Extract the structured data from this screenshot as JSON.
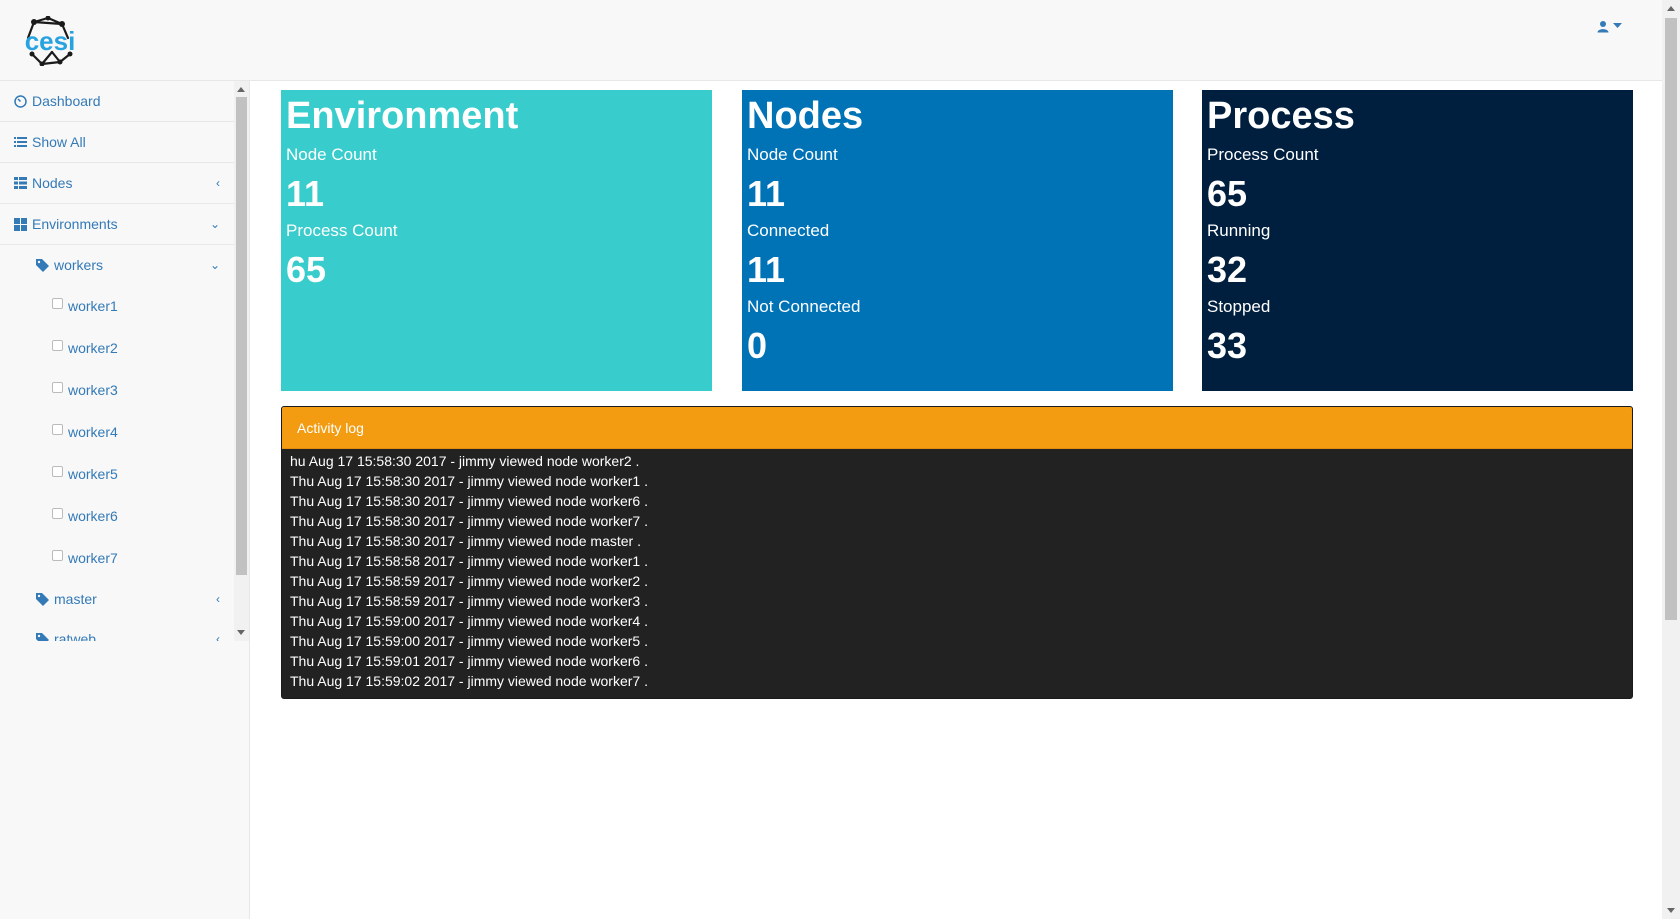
{
  "header": {
    "logo_text": "cesi",
    "user_icon": "user-icon",
    "caret_icon": "caret-down-icon"
  },
  "sidebar": {
    "items": [
      {
        "label": "Dashboard",
        "icon": "dashboard-icon"
      },
      {
        "label": "Show All",
        "icon": "list-icon"
      },
      {
        "label": "Nodes",
        "icon": "table-icon"
      },
      {
        "label": "Environments",
        "icon": "grid-icon"
      }
    ],
    "groups": [
      {
        "label": "workers",
        "icon": "tag-icon"
      },
      {
        "label": "master",
        "icon": "tag-icon"
      },
      {
        "label": "ratweb",
        "icon": "tag-icon"
      }
    ],
    "workers": [
      "worker1",
      "worker2",
      "worker3",
      "worker4",
      "worker5",
      "worker6",
      "worker7"
    ]
  },
  "cards": {
    "environment": {
      "title": "Environment",
      "node_count_label": "Node Count",
      "node_count": "11",
      "process_count_label": "Process Count",
      "process_count": "65",
      "color": "#39cccc"
    },
    "nodes": {
      "title": "Nodes",
      "node_count_label": "Node Count",
      "node_count": "11",
      "connected_label": "Connected",
      "connected": "11",
      "not_connected_label": "Not Connected",
      "not_connected": "0",
      "color": "#0073b7"
    },
    "process": {
      "title": "Process",
      "process_count_label": "Process Count",
      "process_count": "65",
      "running_label": "Running",
      "running": "32",
      "stopped_label": "Stopped",
      "stopped": "33",
      "color": "#001f3f"
    }
  },
  "activity_log": {
    "title": "Activity log",
    "color": "#f39c12",
    "entries": [
      "hu Aug 17 15:58:30 2017 - jimmy viewed node worker2 .",
      "Thu Aug 17 15:58:30 2017 - jimmy viewed node worker1 .",
      "Thu Aug 17 15:58:30 2017 - jimmy viewed node worker6 .",
      "Thu Aug 17 15:58:30 2017 - jimmy viewed node worker7 .",
      "Thu Aug 17 15:58:30 2017 - jimmy viewed node master .",
      "Thu Aug 17 15:58:58 2017 - jimmy viewed node worker1 .",
      "Thu Aug 17 15:58:59 2017 - jimmy viewed node worker2 .",
      "Thu Aug 17 15:58:59 2017 - jimmy viewed node worker3 .",
      "Thu Aug 17 15:59:00 2017 - jimmy viewed node worker4 .",
      "Thu Aug 17 15:59:00 2017 - jimmy viewed node worker5 .",
      "Thu Aug 17 15:59:01 2017 - jimmy viewed node worker6 .",
      "Thu Aug 17 15:59:02 2017 - jimmy viewed node worker7 ."
    ]
  }
}
